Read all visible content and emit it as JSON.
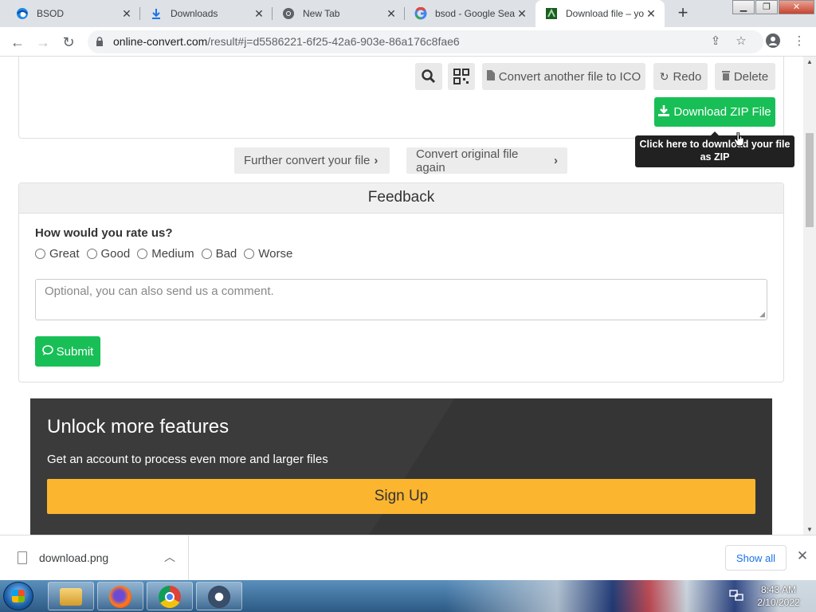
{
  "browser": {
    "tabs": [
      {
        "title": "BSOD",
        "icon": "edge-icon"
      },
      {
        "title": "Downloads",
        "icon": "download-icon"
      },
      {
        "title": "New Tab",
        "icon": "chrome-icon"
      },
      {
        "title": "bsod - Google Sea",
        "icon": "google-icon"
      },
      {
        "title": "Download file – yo",
        "icon": "online-convert-icon"
      }
    ],
    "url_domain": "online-convert.com",
    "url_path": "/result#j=d5586221-6f25-42a6-903e-86a176c8fae6"
  },
  "toolbar": {
    "convert_another": "Convert another file to ICO",
    "redo": "Redo",
    "delete": "Delete",
    "download_zip": "Download ZIP File",
    "tooltip": "Click here to download your file as ZIP"
  },
  "further": {
    "further_convert": "Further convert your file",
    "convert_original": "Convert original file again"
  },
  "feedback": {
    "title": "Feedback",
    "question": "How would you rate us?",
    "options": [
      "Great",
      "Good",
      "Medium",
      "Bad",
      "Worse"
    ],
    "comment_placeholder": "Optional, you can also send us a comment.",
    "submit": "Submit"
  },
  "promo": {
    "title": "Unlock more features",
    "subtitle": "Get an account to process even more and larger files",
    "signup": "Sign Up"
  },
  "downloads_bar": {
    "file": "download.png",
    "show_all": "Show all"
  },
  "taskbar": {
    "time": "8:43 AM",
    "date": "2/10/2022"
  },
  "colors": {
    "green": "#18bf56",
    "orange": "#fbb52f",
    "promo_bg": "#3b3b3b",
    "link_blue": "#1a73e8"
  }
}
